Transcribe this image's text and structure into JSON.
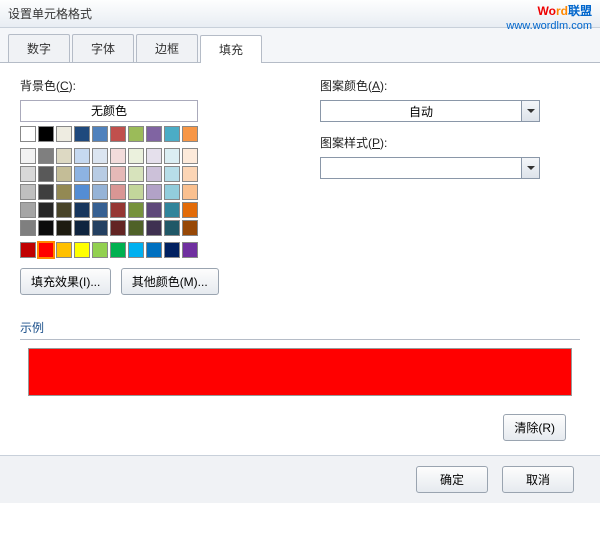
{
  "title": "设置单元格格式",
  "watermark": {
    "brand_a": "Wo",
    "brand_b": "rd",
    "brand_c": "联盟",
    "url": "www.wordlm.com"
  },
  "tabs": {
    "number": "数字",
    "font": "字体",
    "border": "边框",
    "fill": "填充"
  },
  "labels": {
    "bgcolor_pre": "背景色(",
    "bgcolor_key": "C",
    "bgcolor_post": "):",
    "nocolor": "无颜色",
    "pattern_color_pre": "图案颜色(",
    "pattern_color_key": "A",
    "pattern_color_post": "):",
    "pattern_style_pre": "图案样式(",
    "pattern_style_key": "P",
    "pattern_style_post": "):",
    "auto": "自动",
    "preview": "示例"
  },
  "buttons": {
    "fill_effects": "填充效果(I)...",
    "more_colors": "其他颜色(M)...",
    "clear": "清除(R)",
    "ok": "确定",
    "cancel": "取消"
  },
  "colors": {
    "selected": "#f00",
    "theme_row1": [
      "#ffffff",
      "#000000",
      "#eeece1",
      "#1f497d",
      "#4f81bd",
      "#c0504d",
      "#9bbb59",
      "#8064a2",
      "#4bacc6",
      "#f79646"
    ],
    "theme_tints": [
      [
        "#f2f2f2",
        "#7f7f7f",
        "#ddd9c3",
        "#c6d9f0",
        "#dbe5f1",
        "#f2dcdb",
        "#ebf1dd",
        "#e5e0ec",
        "#dbeef3",
        "#fdeada"
      ],
      [
        "#d8d8d8",
        "#595959",
        "#c4bd97",
        "#8db3e2",
        "#b8cce4",
        "#e5b9b7",
        "#d7e3bc",
        "#ccc1d9",
        "#b7dde8",
        "#fbd5b5"
      ],
      [
        "#bfbfbf",
        "#3f3f3f",
        "#938953",
        "#548dd4",
        "#95b3d7",
        "#d99694",
        "#c3d69b",
        "#b2a2c7",
        "#92cddc",
        "#fac08f"
      ],
      [
        "#a5a5a5",
        "#262626",
        "#494429",
        "#17365d",
        "#366092",
        "#953734",
        "#76923c",
        "#5f497a",
        "#31859b",
        "#e36c09"
      ],
      [
        "#7f7f7f",
        "#0c0c0c",
        "#1d1b10",
        "#0f243e",
        "#244061",
        "#632423",
        "#4f6128",
        "#3f3151",
        "#205867",
        "#974806"
      ]
    ],
    "standard": [
      "#c00000",
      "#ff0000",
      "#ffc000",
      "#ffff00",
      "#92d050",
      "#00b050",
      "#00b0f0",
      "#0070c0",
      "#002060",
      "#7030a0"
    ]
  }
}
